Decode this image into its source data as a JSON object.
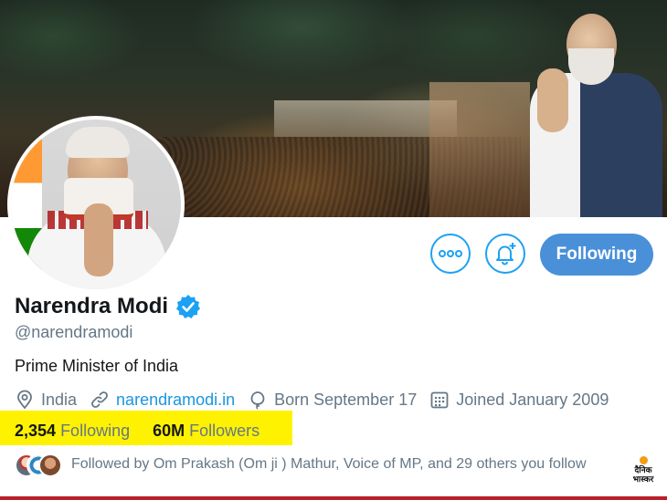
{
  "profile": {
    "name": "Narendra Modi",
    "handle": "@narendramodi",
    "bio": "Prime Minister of India",
    "verified": true,
    "location": "India",
    "website": "narendramodi.in",
    "born": "Born September 17",
    "joined": "Joined January 2009"
  },
  "actions": {
    "more_icon": "more-dots-icon",
    "notify_icon": "bell-plus-icon",
    "follow_label": "Following"
  },
  "stats": {
    "following_count": "2,354",
    "following_label": "Following",
    "followers_count": "60M",
    "followers_label": "Followers"
  },
  "followed_by": {
    "text": "Followed by Om Prakash (Om ji ) Mathur, Voice of MP, and 29 others you follow"
  },
  "watermark": {
    "line1": "दैनिक",
    "line2": "भास्कर"
  },
  "colors": {
    "accent": "#1da1f2",
    "follow_button": "#4a90d9",
    "highlight": "#fff200",
    "muted_text": "#657786",
    "link": "#1b95e0"
  }
}
